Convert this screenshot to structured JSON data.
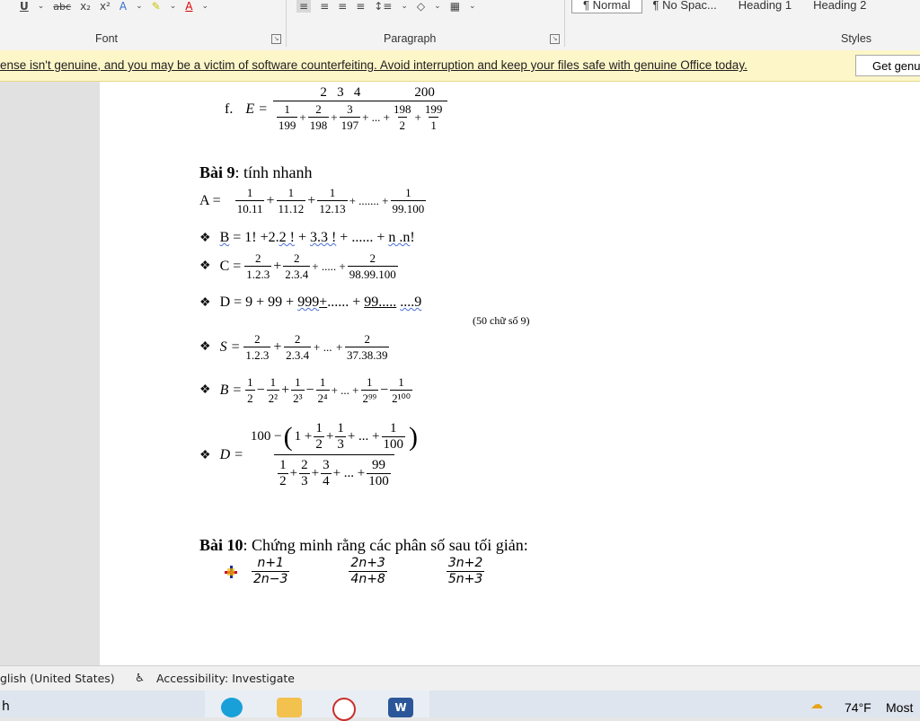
{
  "ribbon": {
    "font_group_label": "Font",
    "paragraph_group_label": "Paragraph",
    "styles_group_label": "Styles",
    "styles": [
      "¶ Normal",
      "¶ No Spac...",
      "Heading 1",
      "Heading 2"
    ],
    "font_tools": [
      "U",
      "abc",
      "x₂",
      "x²",
      "A",
      "A"
    ]
  },
  "license_bar": {
    "message": "ense isn't genuine, and you may be a victim of software counterfeiting. Avoid interruption and keep your files safe with genuine Office today.",
    "button": "Get genu"
  },
  "doc": {
    "f_label": "f.",
    "f_var": "E =",
    "f_numerator": "2   3   4 ... 200",
    "f_num_a": "2",
    "f_num_b": "3",
    "f_num_c": "4",
    "f_num_d": "200",
    "f_dens": [
      [
        "1",
        "199"
      ],
      [
        "2",
        "198"
      ],
      [
        "3",
        "197"
      ],
      [
        "198",
        "2"
      ],
      [
        "199",
        "1"
      ]
    ],
    "bai9_bold": "Bài 9",
    "bai9_rest": ": tính nhanh",
    "A_label": "A =",
    "A_fracs": [
      [
        "1",
        "10.11"
      ],
      [
        "1",
        "11.12"
      ],
      [
        "1",
        "12.13"
      ],
      [
        "1",
        "99.100"
      ]
    ],
    "B_text_1": "B",
    "B_text_2": "= 1! +2.",
    "B_text_3": "2 !",
    "B_text_4": " + ",
    "B_text_5": "3.3 !",
    "B_text_6": " + ...... + ",
    "B_text_7": "n .n",
    "B_text_8": "!",
    "C_label": "C =",
    "C_fracs": [
      [
        "2",
        "1.2.3"
      ],
      [
        "2",
        "2.3.4"
      ],
      [
        "2",
        "98.99.100"
      ]
    ],
    "D_label": "D = 9 + 99 + ",
    "D_text_1": "999",
    "D_text_2": " +",
    "D_text_3": "...... + ",
    "D_text_4": "99.....",
    "D_text_5": "....9",
    "D_note": "(50 chữ số 9)",
    "S_label": "S =",
    "S_fracs": [
      [
        "2",
        "1.2.3"
      ],
      [
        "2",
        "2.3.4"
      ],
      [
        "2",
        "37.38.39"
      ]
    ],
    "B2_label": "B =",
    "B2_fracs": [
      [
        "1",
        "2"
      ],
      [
        "1",
        "2²"
      ],
      [
        "1",
        "2³"
      ],
      [
        "1",
        "2⁴"
      ],
      [
        "1",
        "2⁹⁹"
      ],
      [
        "1",
        "2¹⁰⁰"
      ]
    ],
    "D2_label": "D =",
    "D2_num_start": "100 −",
    "D2_paren": "1 +",
    "D2_inner": [
      [
        "1",
        "2"
      ],
      [
        "1",
        "3"
      ],
      [
        "1",
        "100"
      ]
    ],
    "D2_dens": [
      [
        "1",
        "2"
      ],
      [
        "2",
        "3"
      ],
      [
        "3",
        "4"
      ],
      [
        "99",
        "100"
      ]
    ],
    "bai10_bold": "Bài 10",
    "bai10_rest": ": Chứng minh rằng các phân số sau tối giản:",
    "bai10_fracs": [
      [
        "n+1",
        "2n−3"
      ],
      [
        "2n+3",
        "4n+8"
      ],
      [
        "3n+2",
        "5n+3"
      ]
    ],
    "ellipsis_plus": "+ ... +",
    "dots_plus": "+ ....... +",
    "dots_plus_short": "+ ..... +"
  },
  "status": {
    "language": "glish (United States)",
    "accessibility": "Accessibility: Investigate"
  },
  "taskbar": {
    "search_fragment": "h",
    "weather": "74°F",
    "weather_more": "Most"
  },
  "colors": {
    "license_bar": "#fdf6c8",
    "word_blue": "#2b579a"
  }
}
